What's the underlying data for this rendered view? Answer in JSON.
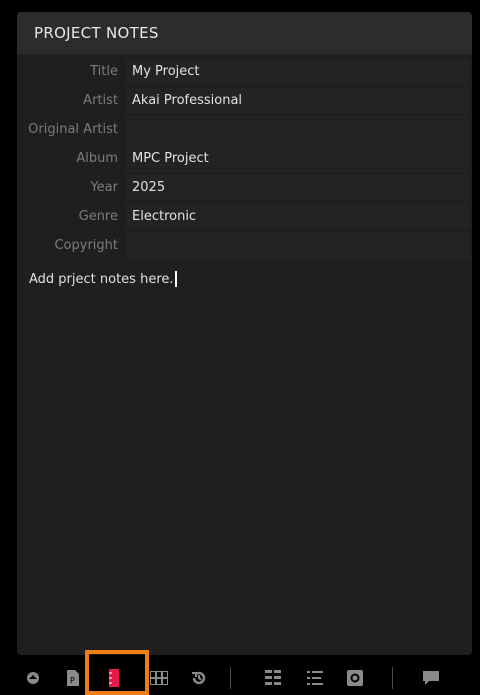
{
  "panel": {
    "title": "PROJECT NOTES"
  },
  "fields": [
    {
      "label": "Title",
      "value": "My Project"
    },
    {
      "label": "Artist",
      "value": "Akai Professional"
    },
    {
      "label": "Original Artist",
      "value": ""
    },
    {
      "label": "Album",
      "value": "MPC Project"
    },
    {
      "label": "Year",
      "value": "2025"
    },
    {
      "label": "Genre",
      "value": "Electronic"
    },
    {
      "label": "Copyright",
      "value": ""
    }
  ],
  "notes": {
    "text": "Add prject notes here."
  },
  "toolbar": {
    "icons": [
      "browser-icon",
      "project-file-icon",
      "notes-icon",
      "grid-editor-icon",
      "history-icon",
      "pad-mixer-icon",
      "list-edit-icon",
      "sample-icon",
      "chat-icon"
    ],
    "active": "notes-icon"
  },
  "colors": {
    "accent": "#e6194b",
    "highlight": "#f07c14",
    "panel": "#1f1f21"
  }
}
